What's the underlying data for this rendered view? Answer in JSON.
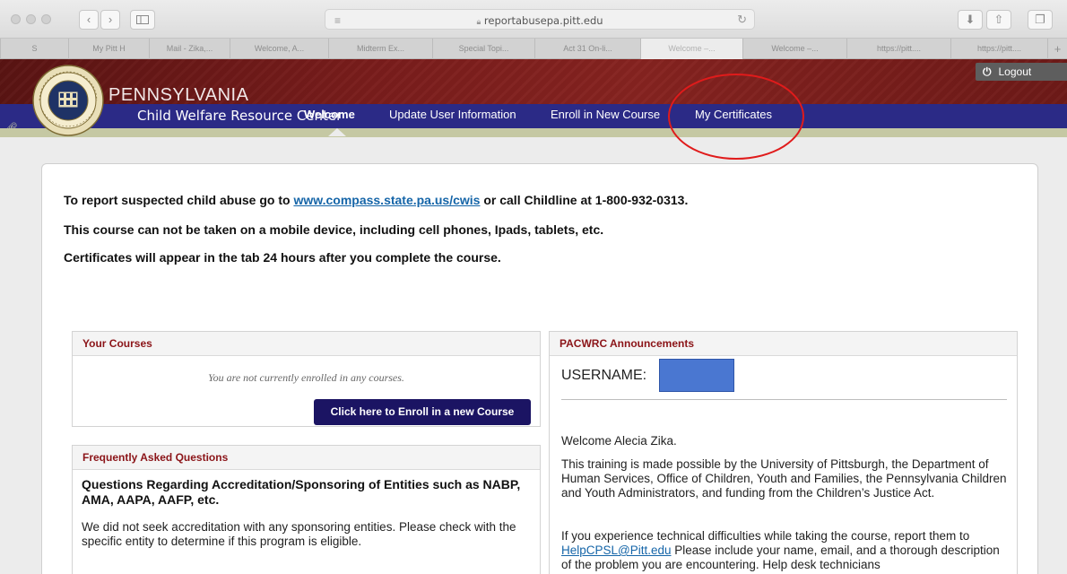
{
  "browser": {
    "url": "reportabusepa.pitt.edu",
    "tabs": [
      {
        "label": "S",
        "active": false
      },
      {
        "label": "My Pitt H",
        "active": false
      },
      {
        "label": "Mail - Zika,...",
        "active": false
      },
      {
        "label": "Welcome, A...",
        "active": false
      },
      {
        "label": "Midterm Ex...",
        "active": false
      },
      {
        "label": "Special Topi...",
        "active": false
      },
      {
        "label": "Act 31 On-li...",
        "active": false
      },
      {
        "label": "Welcome –...",
        "active": true
      },
      {
        "label": "Welcome –...",
        "active": false
      },
      {
        "label": "https://pitt....",
        "active": false
      },
      {
        "label": "https://pitt....",
        "active": false
      }
    ],
    "new_tab": "+"
  },
  "header": {
    "brand_line1": "PENNSYLVANIA",
    "brand_line2": "Child Welfare Resource Center",
    "logout": "Logout",
    "seal_text": "UNIVERSITY OF PITTSBURGH"
  },
  "nav": {
    "items": [
      {
        "label": "Welcome",
        "active": true
      },
      {
        "label": "Update User Information",
        "active": false
      },
      {
        "label": "Enroll in New Course",
        "active": false
      },
      {
        "label": "My Certificates",
        "active": false
      }
    ]
  },
  "notices": {
    "line1_prefix": "To report suspected child abuse go to ",
    "line1_link": "www.compass.state.pa.us/cwis",
    "line1_suffix": " or call Childline at 1-800-932-0313.",
    "line2": "This course can not be taken on a mobile device, including cell phones, Ipads, tablets, etc.",
    "line3": "Certificates will appear in the tab 24 hours after you complete the course."
  },
  "courses_panel": {
    "title": "Your Courses",
    "empty": "You are not currently enrolled in any courses.",
    "button": "Click here to Enroll in a new Course"
  },
  "faq_panel": {
    "title": "Frequently Asked Questions",
    "question": "Questions Regarding Accreditation/Sponsoring of Entities such as NABP, AMA, AAPA, AAFP, etc.",
    "answer": "We did not seek accreditation with any sponsoring entities. Please check with the specific entity to determine if this program is eligible."
  },
  "announcements_panel": {
    "title": "PACWRC Announcements",
    "username_label": "USERNAME:",
    "welcome": "Welcome Alecia Zika.",
    "para1": "This training is made possible by the University of Pittsburgh, the Department of Human Services, Office of Children, Youth and Families, the Pennsylvania Children and Youth Administrators, and funding from the Children’s Justice Act.",
    "para2_prefix": "If you experience technical difficulties while taking the course, report them to ",
    "para2_link": "HelpCPSL@Pitt.edu",
    "para2_suffix": "  Please include your name, email, and a thorough description of the problem you are encountering.  Help desk technicians"
  },
  "colors": {
    "header_red": "#7a1d1c",
    "nav_blue": "#2b2a86",
    "panel_title_red": "#8b1418",
    "button_navy": "#1b1463",
    "link_blue": "#1565a8",
    "annotation_red": "#e01b1b"
  }
}
